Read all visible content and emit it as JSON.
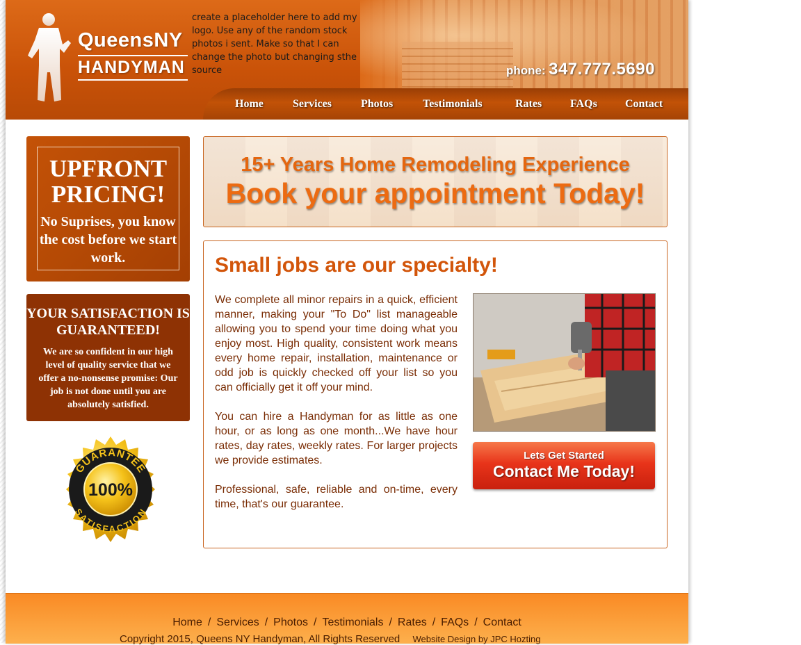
{
  "header": {
    "logo_line1": "QueensNY",
    "logo_line2": "HANDYMAN",
    "placeholder_note": "create a placeholder here to add my logo. Use any of the random stock photos i sent. Make so that I can change the photo but changing sthe source",
    "phone_label": "phone:",
    "phone_number": "347.777.5690"
  },
  "nav": {
    "items": [
      "Home",
      "Services",
      "Photos",
      "Testimonials",
      "Rates",
      "FAQs",
      "Contact"
    ]
  },
  "sidebar": {
    "pricing_title": "UPFRONT PRICING!",
    "pricing_sub": "No Suprises, you know the cost before we start work.",
    "guarantee_title": "YOUR SATISFACTION IS GUARANTEED!",
    "guarantee_text": "We are so confident in our high level of quality service that we offer a no-nonsense promise: Our job is not done until you are absolutely satisfied.",
    "seal_top": "GUARANTEE",
    "seal_center": "100%",
    "seal_bottom": "SATISFACTION"
  },
  "banner": {
    "line1": "15+ Years Home Remodeling Experience",
    "line2": "Book your appointment Today!"
  },
  "main": {
    "heading": "Small jobs are our specialty!",
    "paragraphs": [
      "We complete all minor repairs in a quick, efficient manner, making your \"To Do\" list manageable allowing you to spend your time doing what you enjoy most. High quality, consistent work means every home repair, installation, maintenance or odd job is quickly checked off your list so you can officially get it off your mind.",
      "You can hire a Handyman for as little as one hour, or as long as one month...We have hour rates, day rates, weekly rates. For larger projects we provide estimates.",
      "Professional, safe, reliable and on-time, every time, that's our guarantee."
    ],
    "cta_small": "Lets Get Started",
    "cta_big": "Contact Me Today!"
  },
  "footer": {
    "nav": [
      "Home",
      "Services",
      "Photos",
      "Testimonials",
      "Rates",
      "FAQs",
      "Contact"
    ],
    "copyright": "Copyright 2015, Queens NY Handyman, All Rights Reserved",
    "credit": "Website Design by JPC Hozting"
  },
  "colors": {
    "brand_orange": "#c95208",
    "heading_orange": "#d2550a",
    "dark_brown": "#8e3204",
    "cta_red": "#e8341a"
  }
}
